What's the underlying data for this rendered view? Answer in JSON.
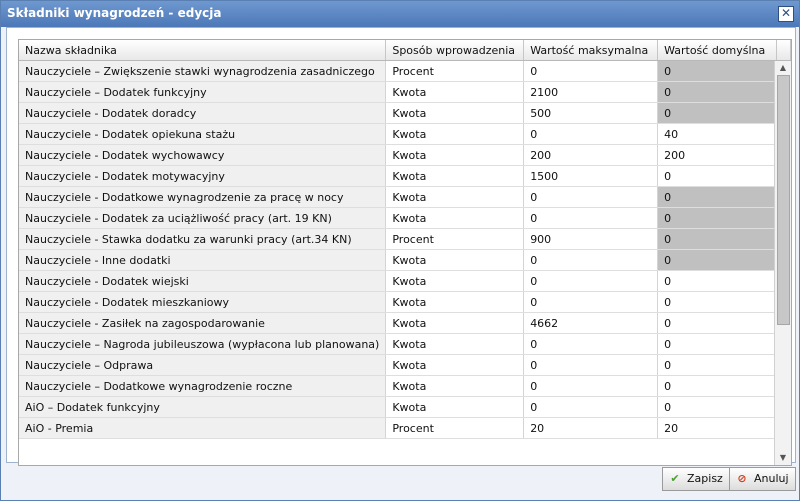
{
  "window": {
    "title": "Składniki wynagrodzeń - edycja",
    "close": "✕"
  },
  "table": {
    "headers": [
      "Nazwa składnika",
      "Sposób wprowadzenia",
      "Wartość maksymalna",
      "Wartość domyślna"
    ],
    "rows": [
      {
        "name": "Nauczyciele – Zwiększenie stawki wynagrodzenia zasadniczego",
        "mode": "Procent",
        "max": "0",
        "def": "0",
        "def_disabled": true
      },
      {
        "name": "Nauczyciele – Dodatek funkcyjny",
        "mode": "Kwota",
        "max": "2100",
        "def": "0",
        "def_disabled": true
      },
      {
        "name": "Nauczyciele - Dodatek doradcy",
        "mode": "Kwota",
        "max": "500",
        "def": "0",
        "def_disabled": true
      },
      {
        "name": "Nauczyciele - Dodatek opiekuna stażu",
        "mode": "Kwota",
        "max": "0",
        "def": "40",
        "def_disabled": false
      },
      {
        "name": "Nauczyciele - Dodatek wychowawcy",
        "mode": "Kwota",
        "max": "200",
        "def": "200",
        "def_disabled": false
      },
      {
        "name": "Nauczyciele - Dodatek motywacyjny",
        "mode": "Kwota",
        "max": "1500",
        "def": "0",
        "def_disabled": false
      },
      {
        "name": "Nauczyciele - Dodatkowe wynagrodzenie za pracę w nocy",
        "mode": "Kwota",
        "max": "0",
        "def": "0",
        "def_disabled": true
      },
      {
        "name": "Nauczyciele - Dodatek za uciążliwość pracy (art. 19 KN)",
        "mode": "Kwota",
        "max": "0",
        "def": "0",
        "def_disabled": true
      },
      {
        "name": "Nauczyciele - Stawka dodatku za warunki pracy (art.34 KN)",
        "mode": "Procent",
        "max": "900",
        "def": "0",
        "def_disabled": true
      },
      {
        "name": "Nauczyciele - Inne dodatki",
        "mode": "Kwota",
        "max": "0",
        "def": "0",
        "def_disabled": true
      },
      {
        "name": "Nauczyciele - Dodatek wiejski",
        "mode": "Kwota",
        "max": "0",
        "def": "0",
        "def_disabled": false
      },
      {
        "name": "Nauczyciele - Dodatek mieszkaniowy",
        "mode": "Kwota",
        "max": "0",
        "def": "0",
        "def_disabled": false
      },
      {
        "name": "Nauczyciele - Zasiłek na zagospodarowanie",
        "mode": "Kwota",
        "max": "4662",
        "def": "0",
        "def_disabled": false
      },
      {
        "name": "Nauczyciele – Nagroda jubileuszowa (wypłacona lub planowana)",
        "mode": "Kwota",
        "max": "0",
        "def": "0",
        "def_disabled": false
      },
      {
        "name": "Nauczyciele – Odprawa",
        "mode": "Kwota",
        "max": "0",
        "def": "0",
        "def_disabled": false
      },
      {
        "name": "Nauczyciele – Dodatkowe wynagrodzenie roczne",
        "mode": "Kwota",
        "max": "0",
        "def": "0",
        "def_disabled": false
      },
      {
        "name": "AiO – Dodatek funkcyjny",
        "mode": "Kwota",
        "max": "0",
        "def": "0",
        "def_disabled": false
      },
      {
        "name": "AiO - Premia",
        "mode": "Procent",
        "max": "20",
        "def": "20",
        "def_disabled": false
      }
    ]
  },
  "buttons": {
    "save": "Zapisz",
    "cancel": "Anuluj",
    "save_icon": "✔",
    "cancel_icon": "⊘"
  },
  "colors": {
    "titlebar": "#5a86c2",
    "disabled_cell": "#c0c0c0",
    "save_icon": "#4aa12e",
    "cancel_icon": "#d23a1a"
  }
}
